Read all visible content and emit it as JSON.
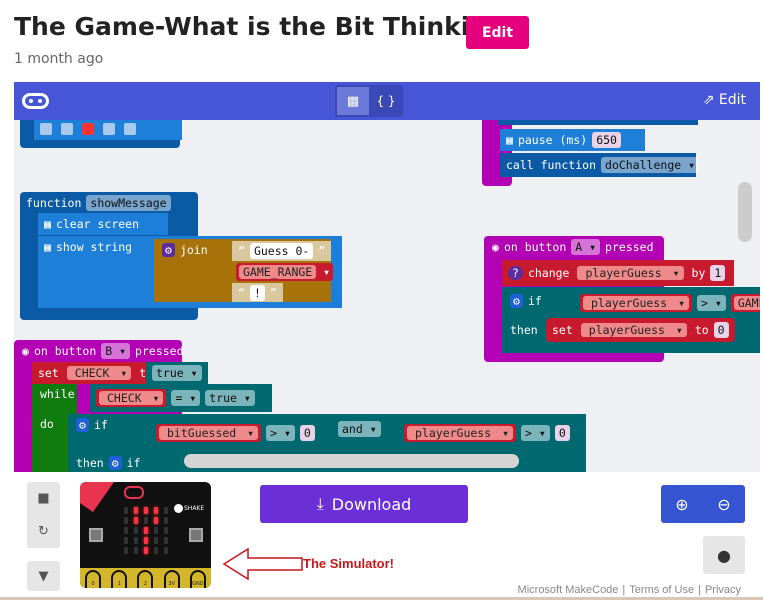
{
  "page": {
    "title": "The Game-What is the Bit Thinking?",
    "edit_label": "Edit",
    "time_ago": "1 month ago"
  },
  "editor": {
    "header_edit": "Edit",
    "toggle_js": "{ }",
    "colors": {
      "header": "#4656d6",
      "download": "#6a2fd6",
      "edit": "#e6007e"
    }
  },
  "blocks": {
    "function_kw": "function",
    "function_name": "showMessage",
    "clear_screen": "clear screen",
    "show_string": "show string",
    "join": "join",
    "str1": "Guess 0-",
    "var_range": "GAME_RANGE",
    "str2": "!",
    "pause": "pause (ms)",
    "pause_val": "650",
    "call_function": "call function",
    "call_name": "doChallenge",
    "on_button": "on button",
    "pressed": "pressed",
    "btn_a": "A",
    "btn_b": "B",
    "change": "change",
    "player_guess": "playerGuess",
    "by": "by",
    "one": "1",
    "if": "if",
    "then": "then",
    "gt": ">",
    "game_trunc": "GAME",
    "set": "set",
    "to": "to",
    "zero": "0",
    "check": "CHECK",
    "true": "true",
    "while": "while",
    "do": "do",
    "eq": "=",
    "bit_guessed": "bitGuessed",
    "and": "and"
  },
  "simulator": {
    "shake": "SHAKE",
    "pins": [
      "0",
      "1",
      "2",
      "3V",
      "GND"
    ],
    "leds": [
      [
        0,
        1,
        1,
        1,
        0
      ],
      [
        0,
        1,
        0,
        1,
        0
      ],
      [
        0,
        0,
        1,
        0,
        0
      ],
      [
        0,
        0,
        1,
        0,
        0
      ],
      [
        0,
        0,
        1,
        0,
        0
      ]
    ],
    "annotation": "The Simulator!"
  },
  "download_label": "Download",
  "footer": [
    "Microsoft MakeCode",
    "Terms of Use",
    "Privacy"
  ]
}
